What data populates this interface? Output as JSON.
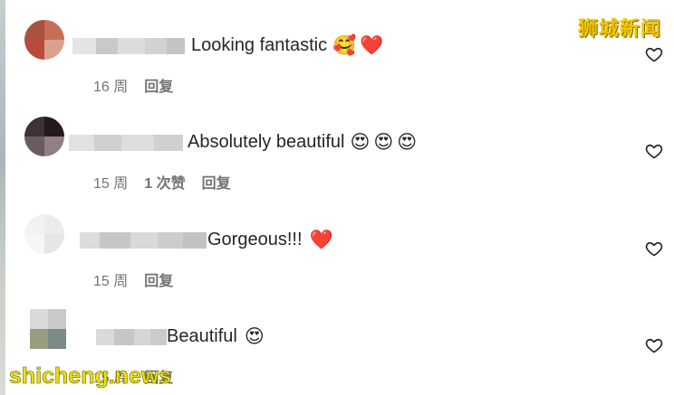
{
  "watermarks": {
    "top": "狮城新闻",
    "bottom": "shicheng.news"
  },
  "comments": [
    {
      "text": "Looking fantastic",
      "emojis": [
        "🥰",
        "❤️"
      ],
      "time": "16 周",
      "likes": "",
      "reply": "回复",
      "avatar_colors": [
        "#a8523f",
        "#c86d55",
        "#b84b3a",
        "#d9a08f"
      ]
    },
    {
      "text": "Absolutely beautiful",
      "emojis": [
        "😍",
        "😍",
        "😍"
      ],
      "time": "15 周",
      "likes": "1 次赞",
      "reply": "回复",
      "avatar_colors": [
        "#3d3238",
        "#231a1d",
        "#6a5b63",
        "#8f7f86"
      ]
    },
    {
      "text": "Gorgeous!!!",
      "emojis": [
        "❤️"
      ],
      "time": "15 周",
      "likes": "",
      "reply": "回复",
      "avatar_colors": [
        "#f2f2f2",
        "#ebebeb",
        "#f6f6f6",
        "#e6e6e6"
      ]
    },
    {
      "text": "Beautiful",
      "emojis": [
        "😍"
      ],
      "time": "15 周",
      "likes": "",
      "reply": "回复",
      "avatar_colors": [
        "#9a9c7e",
        "#b8b39a",
        "#7a8a84",
        "#c9c6b6"
      ]
    }
  ]
}
